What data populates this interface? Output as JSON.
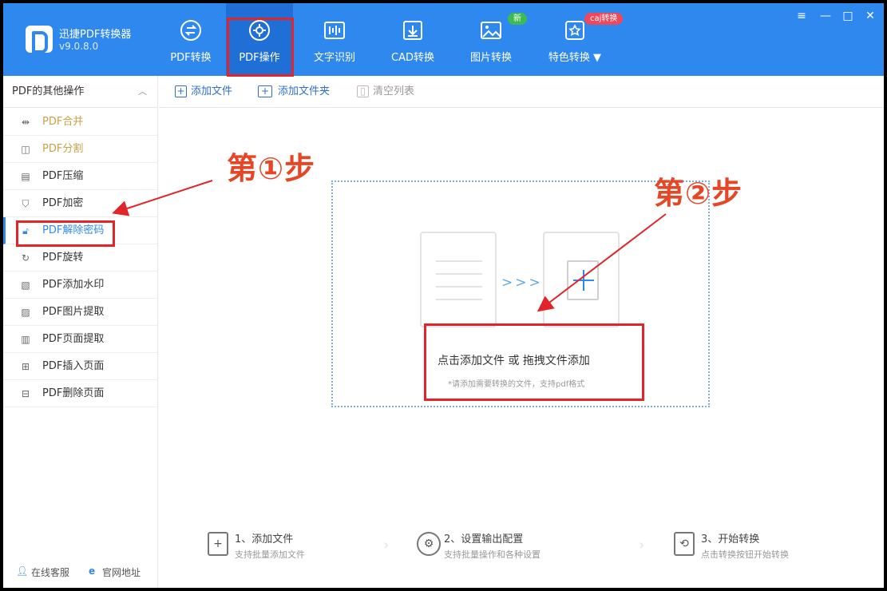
{
  "app": {
    "name": "迅捷PDF转换器",
    "version": "v9.0.8.0"
  },
  "nav": [
    {
      "label": "PDF转换",
      "icon": "pdf-convert-icon"
    },
    {
      "label": "PDF操作",
      "icon": "pdf-operation-icon",
      "active": true
    },
    {
      "label": "文字识别",
      "icon": "ocr-icon"
    },
    {
      "label": "CAD转换",
      "icon": "cad-icon"
    },
    {
      "label": "图片转换",
      "icon": "image-convert-icon",
      "badge": "新"
    },
    {
      "label": "特色转换 ▼",
      "icon": "feature-convert-icon",
      "badge": "caj转换"
    }
  ],
  "window_controls": [
    "≡",
    "—",
    "□",
    "✕"
  ],
  "sidebar": {
    "title": "PDF的其他操作",
    "items": [
      {
        "label": "PDF合并",
        "icon": "⇹"
      },
      {
        "label": "PDF分割",
        "icon": "◫"
      },
      {
        "label": "PDF压缩",
        "icon": "▤"
      },
      {
        "label": "PDF加密",
        "icon": "⛉"
      },
      {
        "label": "PDF解除密码",
        "icon": "🔓︎"
      },
      {
        "label": "PDF旋转",
        "icon": "↻"
      },
      {
        "label": "PDF添加水印",
        "icon": "▧"
      },
      {
        "label": "PDF图片提取",
        "icon": "▨"
      },
      {
        "label": "PDF页面提取",
        "icon": "▥"
      },
      {
        "label": "PDF插入页面",
        "icon": "⊞"
      },
      {
        "label": "PDF删除页面",
        "icon": "⊟"
      }
    ],
    "footer": {
      "service": "在线客服",
      "website": "官网地址"
    }
  },
  "toolbar": {
    "add_file": "添加文件",
    "add_folder": "添加文件夹",
    "clear_list": "清空列表"
  },
  "dropzone": {
    "title": "点击添加文件 或 拖拽文件添加",
    "subtitle": "*请添加需要转换的文件，支持pdf格式"
  },
  "annotations": {
    "step1": "第①步",
    "step2": "第②步"
  },
  "steps": [
    {
      "title": "1、添加文件",
      "subtitle": "支持批量添加文件"
    },
    {
      "title": "2、设置输出配置",
      "subtitle": "支持批量操作和各种设置"
    },
    {
      "title": "3、开始转换",
      "subtitle": "点击转换按钮开始转换"
    }
  ],
  "colors": {
    "header": "#2f88ee",
    "accent": "#2f88ee",
    "annotation": "#e0262b"
  }
}
